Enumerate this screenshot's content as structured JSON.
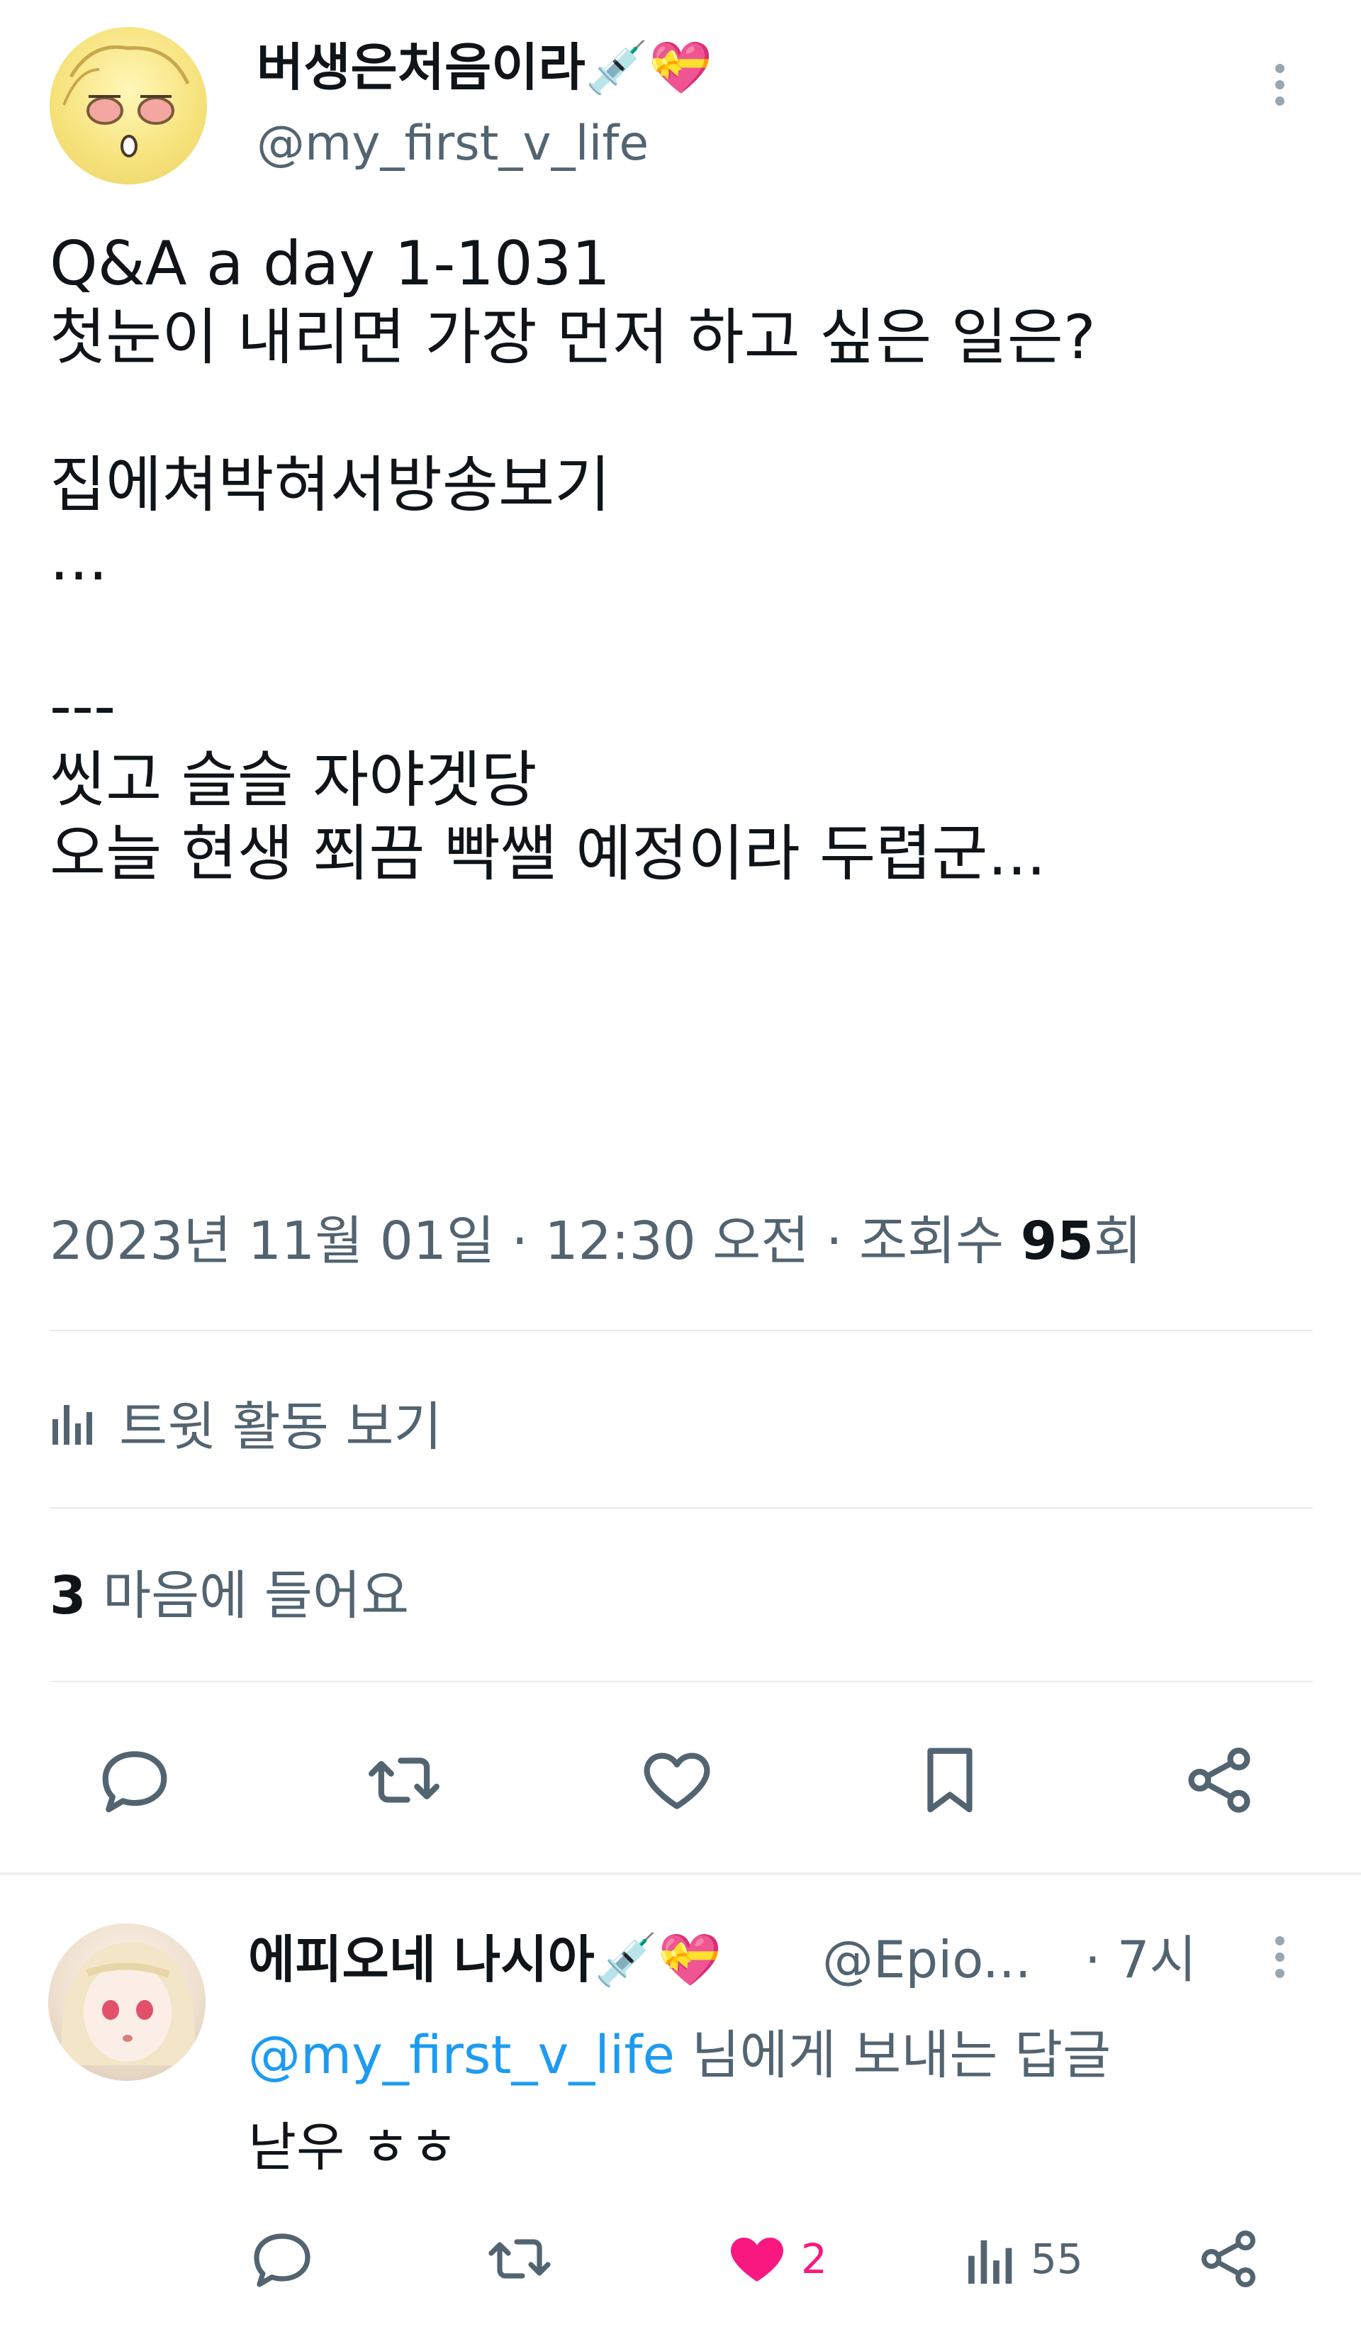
{
  "tweet": {
    "display_name": "버생은처음이라💉💝",
    "handle": "@my_first_v_life",
    "body_lines": [
      "Q&A a day 1-1031",
      "첫눈이 내리면 가장 먼저 하고 싶은 일은?",
      "",
      "집에쳐박혀서방송보기",
      "...",
      "",
      "---",
      "씻고 슬슬 자야겟당",
      "오늘 현생 쬐끔 빡쌜 예정이라 두렵군..."
    ],
    "meta_prefix": "2023년 11월 01일 · 12:30 오전 · 조회수 ",
    "views": "95",
    "views_suffix": "회",
    "activity_label": "트윗 활동 보기",
    "likes_count": "3",
    "likes_label": " 마음에 들어요"
  },
  "actions": {
    "icons": [
      "reply-icon",
      "retweet-icon",
      "like-icon",
      "bookmark-icon",
      "share-icon"
    ]
  },
  "reply": {
    "display_name": "에피오네 나시아💉💝",
    "handle": "@Epio...",
    "time": "· 7시",
    "reply_to_mention": "@my_first_v_life",
    "reply_to_suffix": " 님에게 보내는 답글",
    "text": "낟우 ㅎㅎ",
    "like_count": "2",
    "views_count": "55"
  },
  "colors": {
    "text": "#0f1419",
    "secondary": "#536471",
    "accent": "#1d9bf0",
    "like": "#f91880",
    "divider": "#e6ecf0"
  }
}
